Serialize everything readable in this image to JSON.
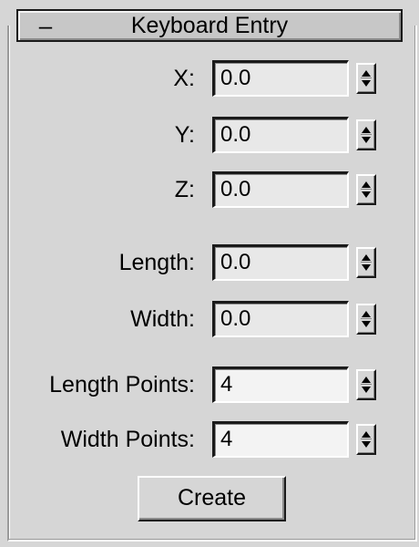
{
  "rollout": {
    "title": "Keyboard Entry",
    "collapse_glyph": "–"
  },
  "fields": [
    {
      "id": "x",
      "label": "X:",
      "value": "0.0"
    },
    {
      "id": "y",
      "label": "Y:",
      "value": "0.0"
    },
    {
      "id": "z",
      "label": "Z:",
      "value": "0.0"
    },
    {
      "id": "length",
      "label": "Length:",
      "value": "0.0"
    },
    {
      "id": "width",
      "label": "Width:",
      "value": "0.0"
    },
    {
      "id": "length_points",
      "label": "Length Points:",
      "value": "4"
    },
    {
      "id": "width_points",
      "label": "Width Points:",
      "value": "4"
    }
  ],
  "create_label": "Create",
  "icons": {
    "collapse": "minus-icon",
    "spinner": "spinner-up-down-icon"
  }
}
